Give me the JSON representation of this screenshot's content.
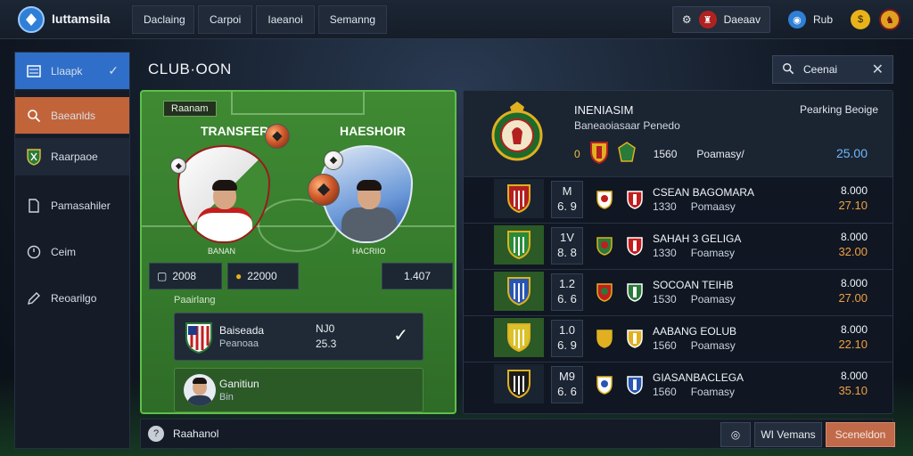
{
  "app": {
    "title": "Iuttamsila"
  },
  "nav": {
    "tabs": [
      "Daclaing",
      "Carpoi",
      "Iaeanoi",
      "Semanng"
    ]
  },
  "top_right": {
    "box_label": "Daeaav",
    "status_label": "Rub"
  },
  "sidebar": {
    "items": [
      {
        "label": "Llaapk",
        "icon": "table-icon"
      },
      {
        "label": "Baeanlds",
        "icon": "search-icon"
      },
      {
        "label": "Raarpaoe",
        "icon": "crest-icon"
      },
      {
        "label": "Pamasahiler",
        "icon": "card-icon"
      },
      {
        "label": "Ceim",
        "icon": "clock-icon"
      },
      {
        "label": "Reoarilgo",
        "icon": "pen-icon"
      }
    ]
  },
  "page": {
    "title": "CLUB·OON",
    "search_label": "Ceenai"
  },
  "transfer": {
    "tag": "Raanam",
    "label_left": "TRANSFER",
    "label_right": "HAESHOIR",
    "name_left": "BANAN",
    "name_right": "HACRIIO",
    "stats": {
      "a": "2008",
      "b": "22000",
      "c": "1.407"
    },
    "ranking_label": "Paairlang",
    "card1": {
      "name": "Baiseada",
      "sub": "Peanoaa",
      "v1": "NJ0",
      "v2": "25.3"
    },
    "card2": {
      "name": "Ganitiun",
      "sub": "Bin"
    }
  },
  "league": {
    "title": "INENIASIM",
    "sub": "Baneaoiasaar Penedo",
    "right_label": "Pearking Beoige",
    "row0": {
      "num": "0",
      "code": "1560",
      "label": "Poamasy/",
      "value": "25.00"
    },
    "teams": [
      {
        "n1": "M",
        "n2": "6. 9",
        "name": "CSEAN BAGOMARA",
        "code": "1330",
        "sub": "Pomaasy",
        "v1": "8.000",
        "v2": "27.10",
        "crest": "#b32020",
        "box": "#1a2431"
      },
      {
        "n1": "1V",
        "n2": "8. 8",
        "name": "SAHAH 3 GELIGA",
        "code": "1330",
        "sub": "Foamasy",
        "v1": "8.000",
        "v2": "32.00",
        "crest": "#2a8a3a",
        "box": "#2b5a26"
      },
      {
        "n1": "1.2",
        "n2": "6. 6",
        "name": "SOCOAN TEIHB",
        "code": "1530",
        "sub": "Poamasy",
        "v1": "8.000",
        "v2": "27.00",
        "crest": "#2856b3",
        "box": "#2b5a26"
      },
      {
        "n1": "1.0",
        "n2": "6. 9",
        "name": "AABANG EOLUB",
        "code": "1560",
        "sub": "Poamasy",
        "v1": "8.000",
        "v2": "22.10",
        "crest": "#d9c22a",
        "box": "#2b5a26"
      },
      {
        "n1": "M9",
        "n2": "6. 6",
        "name": "GIASANBACLEGA",
        "code": "1560",
        "sub": "Foamasy",
        "v1": "8.000",
        "v2": "35.10",
        "crest": "#1c1c1c",
        "box": "#1a2431"
      }
    ]
  },
  "bottom": {
    "label": "Raahanol",
    "btn_md": "WI Vemans",
    "btn_primary": "Sceneldon"
  },
  "colors": {
    "accent_blue": "#2f6fc9",
    "accent_orange": "#c2643a",
    "pitch_green": "#3f8a33",
    "value_orange": "#f0a042"
  }
}
